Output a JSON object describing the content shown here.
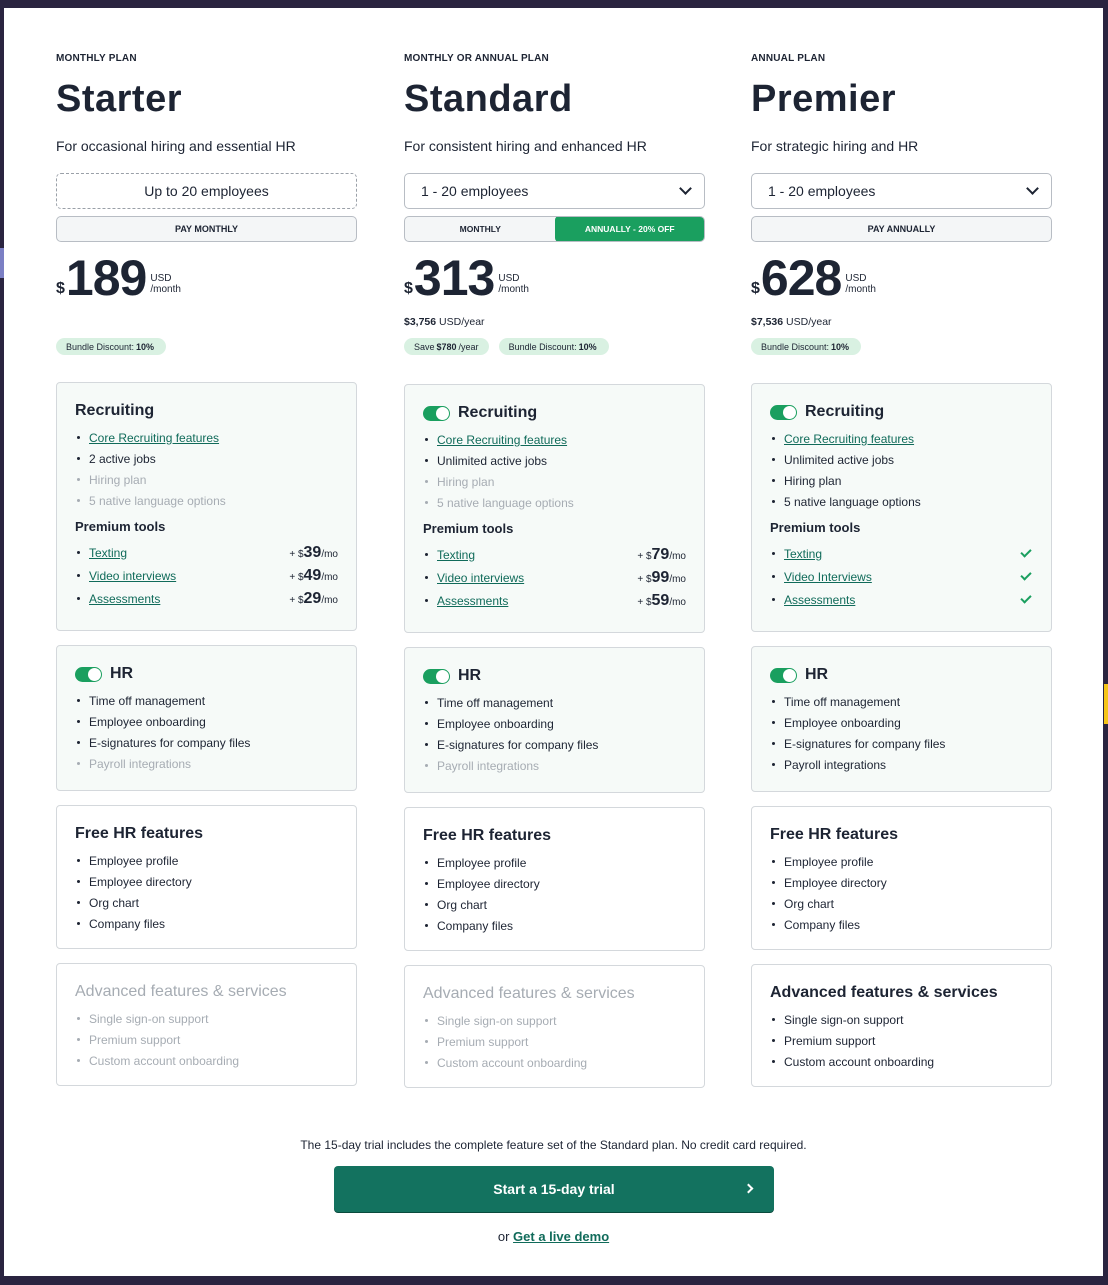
{
  "plans": [
    {
      "eyebrow": "MONTHLY PLAN",
      "name": "Starter",
      "desc": "For occasional hiring and essential HR",
      "employees": "Up to 20 employees",
      "billing": "PAY MONTHLY",
      "currency": "$",
      "price": "189",
      "unit1": "USD",
      "unit2": "/month",
      "bundle_label": "Bundle Discount:",
      "bundle_value": "10%",
      "recruiting": {
        "title": "Recruiting",
        "features": [
          "Core Recruiting features",
          "2 active jobs",
          "Hiring plan",
          "5 native language options"
        ],
        "tools_title": "Premium tools",
        "tools": [
          {
            "name": "Texting",
            "prefix": "+ $",
            "amount": "39",
            "suffix": "/mo"
          },
          {
            "name": "Video interviews",
            "prefix": "+ $",
            "amount": "49",
            "suffix": "/mo"
          },
          {
            "name": "Assessments",
            "prefix": "+ $",
            "amount": "29",
            "suffix": "/mo"
          }
        ]
      },
      "hr": {
        "title": "HR",
        "features": [
          "Time off management",
          "Employee onboarding",
          "E-signatures for company files",
          "Payroll integrations"
        ]
      },
      "free": {
        "title": "Free HR features",
        "features": [
          "Employee profile",
          "Employee directory",
          "Org chart",
          "Company files"
        ]
      },
      "adv": {
        "title": "Advanced features & services",
        "features": [
          "Single sign-on support",
          "Premium support",
          "Custom account onboarding"
        ]
      }
    },
    {
      "eyebrow": "MONTHLY OR ANNUAL PLAN",
      "name": "Standard",
      "desc": "For consistent hiring and enhanced HR",
      "employees": "1 - 20 employees",
      "billing_monthly": "MONTHLY",
      "billing_annual": "ANNUALLY - 20% OFF",
      "currency": "$",
      "price": "313",
      "unit1": "USD",
      "unit2": "/month",
      "yearly_amount": "$3,756",
      "yearly_unit": "USD/year",
      "save_label": "Save",
      "save_value": "$780",
      "save_unit": "/year",
      "bundle_label": "Bundle Discount:",
      "bundle_value": "10%",
      "recruiting": {
        "title": "Recruiting",
        "features": [
          "Core Recruiting features",
          "Unlimited active jobs",
          "Hiring plan",
          "5 native language options"
        ],
        "tools_title": "Premium tools",
        "tools": [
          {
            "name": "Texting",
            "prefix": "+ $",
            "amount": "79",
            "suffix": "/mo"
          },
          {
            "name": "Video interviews",
            "prefix": "+ $",
            "amount": "99",
            "suffix": "/mo"
          },
          {
            "name": "Assessments",
            "prefix": "+ $",
            "amount": "59",
            "suffix": "/mo"
          }
        ]
      },
      "hr": {
        "title": "HR",
        "features": [
          "Time off management",
          "Employee onboarding",
          "E-signatures for company files",
          "Payroll integrations"
        ]
      },
      "free": {
        "title": "Free HR features",
        "features": [
          "Employee profile",
          "Employee directory",
          "Org chart",
          "Company files"
        ]
      },
      "adv": {
        "title": "Advanced features & services",
        "features": [
          "Single sign-on support",
          "Premium support",
          "Custom account onboarding"
        ]
      }
    },
    {
      "eyebrow": "ANNUAL PLAN",
      "name": "Premier",
      "desc": "For strategic hiring and HR",
      "employees": "1 - 20 employees",
      "billing": "PAY ANNUALLY",
      "currency": "$",
      "price": "628",
      "unit1": "USD",
      "unit2": "/month",
      "yearly_amount": "$7,536",
      "yearly_unit": "USD/year",
      "bundle_label": "Bundle Discount:",
      "bundle_value": "10%",
      "recruiting": {
        "title": "Recruiting",
        "features": [
          "Core Recruiting features",
          "Unlimited active jobs",
          "Hiring plan",
          "5 native language options"
        ],
        "tools_title": "Premium tools",
        "tools": [
          {
            "name": "Texting"
          },
          {
            "name": "Video Interviews"
          },
          {
            "name": "Assessments"
          }
        ]
      },
      "hr": {
        "title": "HR",
        "features": [
          "Time off management",
          "Employee onboarding",
          "E-signatures for company files",
          "Payroll integrations"
        ]
      },
      "free": {
        "title": "Free HR features",
        "features": [
          "Employee profile",
          "Employee directory",
          "Org chart",
          "Company files"
        ]
      },
      "adv": {
        "title": "Advanced features & services",
        "features": [
          "Single sign-on support",
          "Premium support",
          "Custom account onboarding"
        ]
      }
    }
  ],
  "footer": {
    "trial_note": "The 15-day trial includes the complete feature set of the Standard plan. No credit card required.",
    "cta_label": "Start a 15-day trial",
    "demo_prefix": "or",
    "demo_link": "Get a live demo"
  },
  "colors": {
    "accent": "#1a9f5f",
    "cta": "#13725f",
    "link": "#106b5a",
    "badge": "#d9f1e2"
  }
}
